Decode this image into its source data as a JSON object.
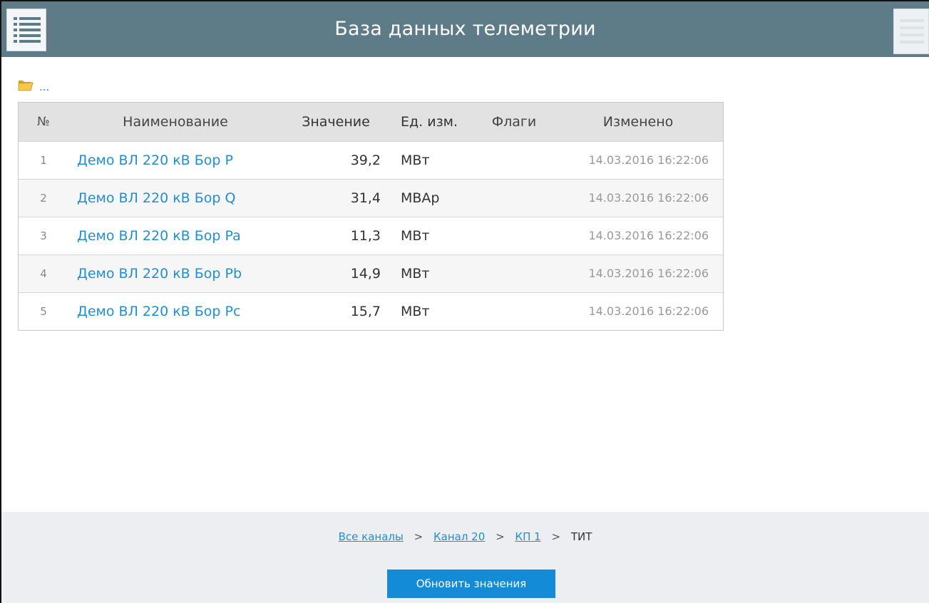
{
  "header": {
    "title": "База данных телеметрии",
    "left_icon": "list-menu-icon",
    "right_icon": "hamburger-menu-icon"
  },
  "navigation": {
    "up_icon": "folder-icon",
    "up_label": "..."
  },
  "table": {
    "columns": [
      "№",
      "Наименование",
      "Значение",
      "Ед. изм.",
      "Флаги",
      "Изменено"
    ],
    "rows": [
      {
        "num": "1",
        "name": "Демо ВЛ 220 кВ Бор P",
        "value": "39,2",
        "unit": "МВт",
        "flags": "",
        "changed": "14.03.2016 16:22:06"
      },
      {
        "num": "2",
        "name": "Демо ВЛ 220 кВ Бор Q",
        "value": "31,4",
        "unit": "МВАр",
        "flags": "",
        "changed": "14.03.2016 16:22:06"
      },
      {
        "num": "3",
        "name": "Демо ВЛ 220 кВ Бор Pa",
        "value": "11,3",
        "unit": "МВт",
        "flags": "",
        "changed": "14.03.2016 16:22:06"
      },
      {
        "num": "4",
        "name": "Демо ВЛ 220 кВ Бор Pb",
        "value": "14,9",
        "unit": "МВт",
        "flags": "",
        "changed": "14.03.2016 16:22:06"
      },
      {
        "num": "5",
        "name": "Демо ВЛ 220 кВ Бор Pc",
        "value": "15,7",
        "unit": "МВт",
        "flags": "",
        "changed": "14.03.2016 16:22:06"
      }
    ]
  },
  "footer": {
    "breadcrumb": {
      "all_channels": "Все каналы",
      "channel": "Канал 20",
      "kp": "КП 1",
      "current": "ТИТ",
      "separator": ">"
    },
    "refresh_label": "Обновить значения"
  },
  "colors": {
    "header_bg": "#5e7b88",
    "link": "#1f8fd4",
    "button": "#148bd7",
    "footer_bg": "#eceef1"
  }
}
